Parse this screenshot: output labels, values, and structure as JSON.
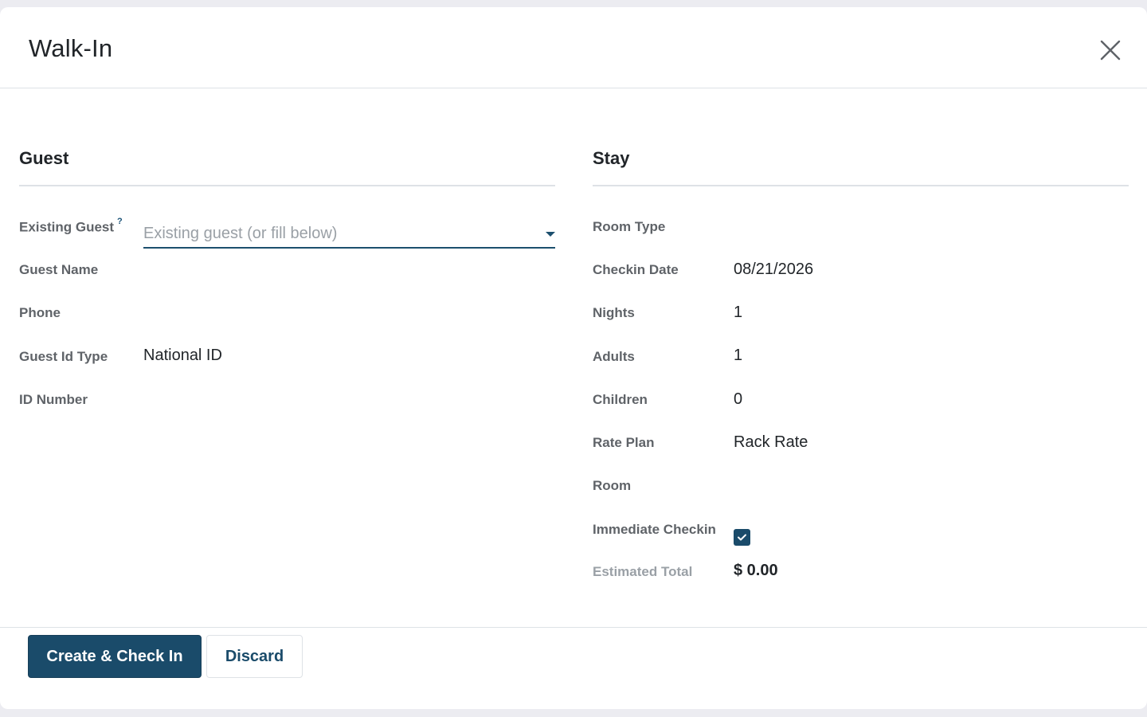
{
  "modal": {
    "title": "Walk-In"
  },
  "guest_section": {
    "title": "Guest",
    "existing_guest": {
      "label": "Existing Guest",
      "help": "?",
      "placeholder": "Existing guest (or fill below)"
    },
    "guest_name": {
      "label": "Guest Name",
      "value": ""
    },
    "phone": {
      "label": "Phone",
      "value": ""
    },
    "guest_id_type": {
      "label": "Guest Id Type",
      "value": "National ID"
    },
    "id_number": {
      "label": "ID Number",
      "value": ""
    }
  },
  "stay_section": {
    "title": "Stay",
    "room_type": {
      "label": "Room Type",
      "value": ""
    },
    "checkin_date": {
      "label": "Checkin Date",
      "value": "08/21/2026"
    },
    "nights": {
      "label": "Nights",
      "value": "1"
    },
    "adults": {
      "label": "Adults",
      "value": "1"
    },
    "children": {
      "label": "Children",
      "value": "0"
    },
    "rate_plan": {
      "label": "Rate Plan",
      "value": "Rack Rate"
    },
    "room": {
      "label": "Room",
      "value": ""
    },
    "immediate_checkin": {
      "label": "Immediate Checkin",
      "checked": true
    },
    "estimated_total": {
      "label": "Estimated Total",
      "value": "$ 0.00"
    }
  },
  "footer": {
    "primary_label": "Create & Check In",
    "secondary_label": "Discard"
  },
  "icons": {
    "close": "close-icon",
    "dropdown": "chevron-down-icon",
    "checkbox": "check-icon"
  },
  "colors": {
    "accent": "#1a4b6a",
    "label": "#5f6368",
    "muted": "#9aa0a6",
    "divider": "#dee2e6"
  }
}
